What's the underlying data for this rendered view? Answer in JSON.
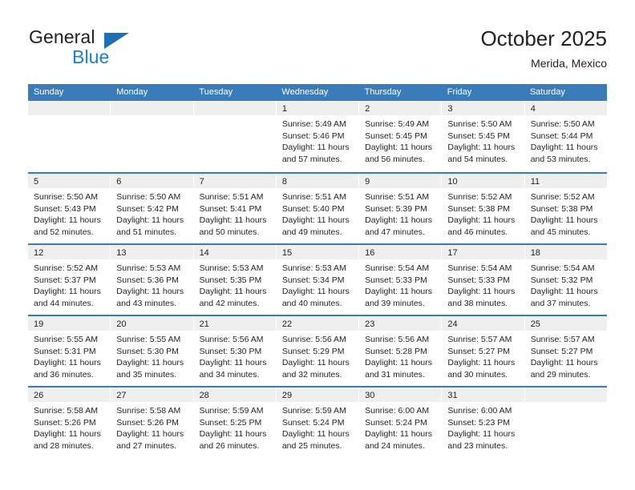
{
  "brand": {
    "name_top": "General",
    "name_bottom": "Blue",
    "triangle_icon": "blue-triangle-logo-mark",
    "color_dark": "#231f20",
    "color_blue": "#1a7fd4"
  },
  "header": {
    "title": "October 2025",
    "subtitle": "Merida, Mexico"
  },
  "colors": {
    "header_blue": "#3a7cba",
    "day_band_gray": "#efefef",
    "text": "#231f20",
    "cell_white": "#ffffff"
  },
  "weekdays": [
    "Sunday",
    "Monday",
    "Tuesday",
    "Wednesday",
    "Thursday",
    "Friday",
    "Saturday"
  ],
  "weeks": [
    [
      {
        "day": "",
        "lines": []
      },
      {
        "day": "",
        "lines": []
      },
      {
        "day": "",
        "lines": []
      },
      {
        "day": "1",
        "lines": [
          "Sunrise: 5:49 AM",
          "Sunset: 5:46 PM",
          "Daylight: 11 hours",
          "and 57 minutes."
        ]
      },
      {
        "day": "2",
        "lines": [
          "Sunrise: 5:49 AM",
          "Sunset: 5:45 PM",
          "Daylight: 11 hours",
          "and 56 minutes."
        ]
      },
      {
        "day": "3",
        "lines": [
          "Sunrise: 5:50 AM",
          "Sunset: 5:45 PM",
          "Daylight: 11 hours",
          "and 54 minutes."
        ]
      },
      {
        "day": "4",
        "lines": [
          "Sunrise: 5:50 AM",
          "Sunset: 5:44 PM",
          "Daylight: 11 hours",
          "and 53 minutes."
        ]
      }
    ],
    [
      {
        "day": "5",
        "lines": [
          "Sunrise: 5:50 AM",
          "Sunset: 5:43 PM",
          "Daylight: 11 hours",
          "and 52 minutes."
        ]
      },
      {
        "day": "6",
        "lines": [
          "Sunrise: 5:50 AM",
          "Sunset: 5:42 PM",
          "Daylight: 11 hours",
          "and 51 minutes."
        ]
      },
      {
        "day": "7",
        "lines": [
          "Sunrise: 5:51 AM",
          "Sunset: 5:41 PM",
          "Daylight: 11 hours",
          "and 50 minutes."
        ]
      },
      {
        "day": "8",
        "lines": [
          "Sunrise: 5:51 AM",
          "Sunset: 5:40 PM",
          "Daylight: 11 hours",
          "and 49 minutes."
        ]
      },
      {
        "day": "9",
        "lines": [
          "Sunrise: 5:51 AM",
          "Sunset: 5:39 PM",
          "Daylight: 11 hours",
          "and 47 minutes."
        ]
      },
      {
        "day": "10",
        "lines": [
          "Sunrise: 5:52 AM",
          "Sunset: 5:38 PM",
          "Daylight: 11 hours",
          "and 46 minutes."
        ]
      },
      {
        "day": "11",
        "lines": [
          "Sunrise: 5:52 AM",
          "Sunset: 5:38 PM",
          "Daylight: 11 hours",
          "and 45 minutes."
        ]
      }
    ],
    [
      {
        "day": "12",
        "lines": [
          "Sunrise: 5:52 AM",
          "Sunset: 5:37 PM",
          "Daylight: 11 hours",
          "and 44 minutes."
        ]
      },
      {
        "day": "13",
        "lines": [
          "Sunrise: 5:53 AM",
          "Sunset: 5:36 PM",
          "Daylight: 11 hours",
          "and 43 minutes."
        ]
      },
      {
        "day": "14",
        "lines": [
          "Sunrise: 5:53 AM",
          "Sunset: 5:35 PM",
          "Daylight: 11 hours",
          "and 42 minutes."
        ]
      },
      {
        "day": "15",
        "lines": [
          "Sunrise: 5:53 AM",
          "Sunset: 5:34 PM",
          "Daylight: 11 hours",
          "and 40 minutes."
        ]
      },
      {
        "day": "16",
        "lines": [
          "Sunrise: 5:54 AM",
          "Sunset: 5:33 PM",
          "Daylight: 11 hours",
          "and 39 minutes."
        ]
      },
      {
        "day": "17",
        "lines": [
          "Sunrise: 5:54 AM",
          "Sunset: 5:33 PM",
          "Daylight: 11 hours",
          "and 38 minutes."
        ]
      },
      {
        "day": "18",
        "lines": [
          "Sunrise: 5:54 AM",
          "Sunset: 5:32 PM",
          "Daylight: 11 hours",
          "and 37 minutes."
        ]
      }
    ],
    [
      {
        "day": "19",
        "lines": [
          "Sunrise: 5:55 AM",
          "Sunset: 5:31 PM",
          "Daylight: 11 hours",
          "and 36 minutes."
        ]
      },
      {
        "day": "20",
        "lines": [
          "Sunrise: 5:55 AM",
          "Sunset: 5:30 PM",
          "Daylight: 11 hours",
          "and 35 minutes."
        ]
      },
      {
        "day": "21",
        "lines": [
          "Sunrise: 5:56 AM",
          "Sunset: 5:30 PM",
          "Daylight: 11 hours",
          "and 34 minutes."
        ]
      },
      {
        "day": "22",
        "lines": [
          "Sunrise: 5:56 AM",
          "Sunset: 5:29 PM",
          "Daylight: 11 hours",
          "and 32 minutes."
        ]
      },
      {
        "day": "23",
        "lines": [
          "Sunrise: 5:56 AM",
          "Sunset: 5:28 PM",
          "Daylight: 11 hours",
          "and 31 minutes."
        ]
      },
      {
        "day": "24",
        "lines": [
          "Sunrise: 5:57 AM",
          "Sunset: 5:27 PM",
          "Daylight: 11 hours",
          "and 30 minutes."
        ]
      },
      {
        "day": "25",
        "lines": [
          "Sunrise: 5:57 AM",
          "Sunset: 5:27 PM",
          "Daylight: 11 hours",
          "and 29 minutes."
        ]
      }
    ],
    [
      {
        "day": "26",
        "lines": [
          "Sunrise: 5:58 AM",
          "Sunset: 5:26 PM",
          "Daylight: 11 hours",
          "and 28 minutes."
        ]
      },
      {
        "day": "27",
        "lines": [
          "Sunrise: 5:58 AM",
          "Sunset: 5:26 PM",
          "Daylight: 11 hours",
          "and 27 minutes."
        ]
      },
      {
        "day": "28",
        "lines": [
          "Sunrise: 5:59 AM",
          "Sunset: 5:25 PM",
          "Daylight: 11 hours",
          "and 26 minutes."
        ]
      },
      {
        "day": "29",
        "lines": [
          "Sunrise: 5:59 AM",
          "Sunset: 5:24 PM",
          "Daylight: 11 hours",
          "and 25 minutes."
        ]
      },
      {
        "day": "30",
        "lines": [
          "Sunrise: 6:00 AM",
          "Sunset: 5:24 PM",
          "Daylight: 11 hours",
          "and 24 minutes."
        ]
      },
      {
        "day": "31",
        "lines": [
          "Sunrise: 6:00 AM",
          "Sunset: 5:23 PM",
          "Daylight: 11 hours",
          "and 23 minutes."
        ]
      },
      {
        "day": "",
        "lines": []
      }
    ]
  ]
}
